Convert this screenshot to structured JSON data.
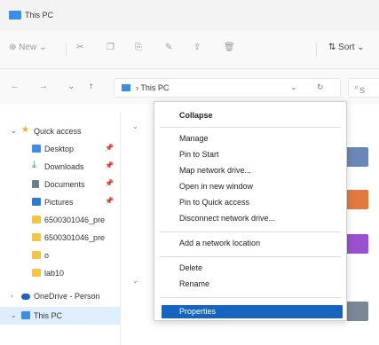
{
  "window": {
    "title": "This PC"
  },
  "toolbar": {
    "new_label": "New",
    "sort_label": "Sort"
  },
  "address": {
    "path": "This PC",
    "search_placeholder": "S"
  },
  "sidebar": {
    "items": [
      {
        "label": "Quick access",
        "icon": "star-icon",
        "color": "#f2b01e"
      },
      {
        "label": "Desktop",
        "icon": "desktop-icon",
        "color": "#3a8ee6"
      },
      {
        "label": "Downloads",
        "icon": "download-icon",
        "color": "#2b7bd6"
      },
      {
        "label": "Documents",
        "icon": "document-icon",
        "color": "#6b7c93"
      },
      {
        "label": "Pictures",
        "icon": "picture-icon",
        "color": "#2b7bd6"
      },
      {
        "label": "6500301046_pre",
        "icon": "folder-icon",
        "color": "#f4c542"
      },
      {
        "label": "6500301046_pre",
        "icon": "folder-icon",
        "color": "#f4c542"
      },
      {
        "label": "o",
        "icon": "folder-icon",
        "color": "#f4c542"
      },
      {
        "label": "lab10",
        "icon": "folder-icon",
        "color": "#f4c542"
      },
      {
        "label": "OneDrive - Person",
        "icon": "cloud-icon",
        "color": "#1e63c4"
      },
      {
        "label": "This PC",
        "icon": "pc-icon",
        "color": "#3a8ee6"
      }
    ]
  },
  "context_menu": {
    "items": [
      "Collapse",
      "Manage",
      "Pin to Start",
      "Map network drive...",
      "Open in new window",
      "Pin to Quick access",
      "Disconnect network drive...",
      "Add a network location",
      "Delete",
      "Rename",
      "Properties"
    ],
    "selected": "Properties",
    "highlight_color": "#1565c0"
  }
}
